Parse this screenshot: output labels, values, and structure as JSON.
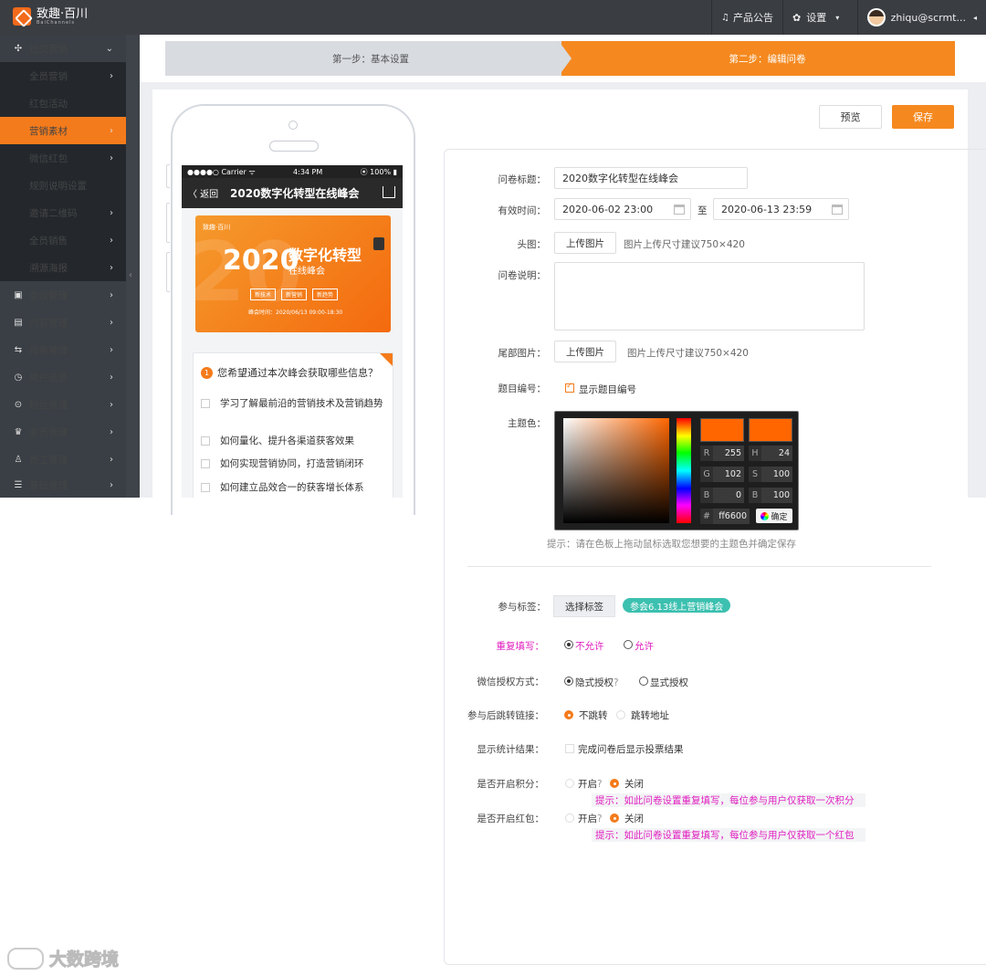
{
  "brand": {
    "name": "致趣·百川",
    "sub": "BaiChannels",
    "accent": "#f47b1b"
  },
  "topbar": {
    "announce": "产品公告",
    "settings": "设置",
    "user": "zhiqu@scrmt..."
  },
  "sidebar": {
    "items": [
      {
        "label": "社交营销",
        "icon": "share-icon",
        "arrow": "⌄"
      },
      {
        "label": "全员营销",
        "arrow": "›"
      },
      {
        "label": "红包活动",
        "arrow": ""
      },
      {
        "label": "营销素材",
        "arrow": "›"
      },
      {
        "label": "微信红包",
        "arrow": "›"
      },
      {
        "label": "规则说明设置",
        "arrow": ""
      },
      {
        "label": "邀请二维码",
        "arrow": "›"
      },
      {
        "label": "全员销售",
        "arrow": "›"
      },
      {
        "label": "溯源海报",
        "arrow": "›"
      },
      {
        "label": "会议管理",
        "icon": "meeting-icon",
        "arrow": "›"
      },
      {
        "label": "内容管理",
        "icon": "content-icon",
        "arrow": "›"
      },
      {
        "label": "线索管理",
        "icon": "leads-icon",
        "arrow": "›"
      },
      {
        "label": "用户运营",
        "icon": "user-ops-icon",
        "arrow": "›"
      },
      {
        "label": "粉丝管理",
        "icon": "fans-icon",
        "arrow": "›"
      },
      {
        "label": "会员管理",
        "icon": "crown-icon",
        "arrow": "›"
      },
      {
        "label": "员工管理",
        "icon": "staff-icon",
        "arrow": "›"
      },
      {
        "label": "基础管理",
        "icon": "base-icon",
        "arrow": "›"
      }
    ]
  },
  "steps": {
    "step1": "第一步：基本设置",
    "step2": "第二步：编辑问卷"
  },
  "actions": {
    "preview": "预览",
    "save": "保存"
  },
  "phone": {
    "carrier": "●●●●○ Carrier ᯤ",
    "time": "4:34 PM",
    "battery": "⦿ 100% ▮",
    "back": "〈 返回",
    "title": "2020数字化转型在线峰会",
    "banner": {
      "logo": "致趣·百川",
      "year": "2020",
      "title": "数字化转型",
      "subtitle": "在线峰会",
      "tags": [
        "新技术",
        "新营销",
        "新趋势"
      ],
      "time": "峰会时间：2020/06/13 09:00-18:30"
    },
    "question": {
      "num": "1",
      "title": "您希望通过本次峰会获取哪些信息？",
      "options": [
        "学习了解最前沿的营销技术及营销趋势",
        "如何量化、提升各渠道获客效果",
        "如何实现营销协同，打造营销闭环",
        "如何建立品效合一的获客增长体系"
      ]
    }
  },
  "form": {
    "title_label": "问卷标题：",
    "title_value": "2020数字化转型在线峰会",
    "time_label": "有效时间：",
    "time_start": "2020-06-02 23:00",
    "time_sep": "至",
    "time_end": "2020-06-13 23:59",
    "head_label": "头图：",
    "upload_label": "上传图片",
    "head_hint": "图片上传尺寸建议750×420",
    "desc_label": "问卷说明：",
    "tail_label": "尾部图片：",
    "tail_hint": "图片上传尺寸建议750×420",
    "num_label": "题目编号：",
    "num_check": "显示题目编号",
    "theme_label": "主题色：",
    "theme_hint": "提示：请在色板上拖动鼠标选取您想要的主题色并确定保存",
    "tags_label": "参与标签：",
    "tags_btn": "选择标签",
    "tag_value": "参会6.13线上营销峰会",
    "repeat_label": "重复填写：",
    "repeat_opts": [
      "不允许",
      "允许"
    ],
    "auth_label": "微信授权方式：",
    "auth_opts": [
      "隐式授权",
      "显式授权"
    ],
    "redirect_label": "参与后跳转链接：",
    "redirect_opts": [
      "不跳转",
      "跳转地址"
    ],
    "stats_label": "显示统计结果：",
    "stats_check": "完成问卷后显示投票结果",
    "points_label": "是否开启积分：",
    "points_opts": [
      "开启",
      "关闭"
    ],
    "points_tip": "提示：如此问卷设置重复填写，每位参与用户仅获取一次积分",
    "redpack_label": "是否开启红包：",
    "redpack_opts": [
      "开启",
      "关闭"
    ],
    "redpack_tip": "提示：如此问卷设置重复填写，每位参与用户仅获取一个红包"
  },
  "picker": {
    "color": "#ff6600",
    "r": "255",
    "g": "102",
    "b": "0",
    "h": "24",
    "s": "100",
    "bv": "100",
    "hex": "ff6600",
    "ok": "确定"
  },
  "watermark": "大数跨境"
}
